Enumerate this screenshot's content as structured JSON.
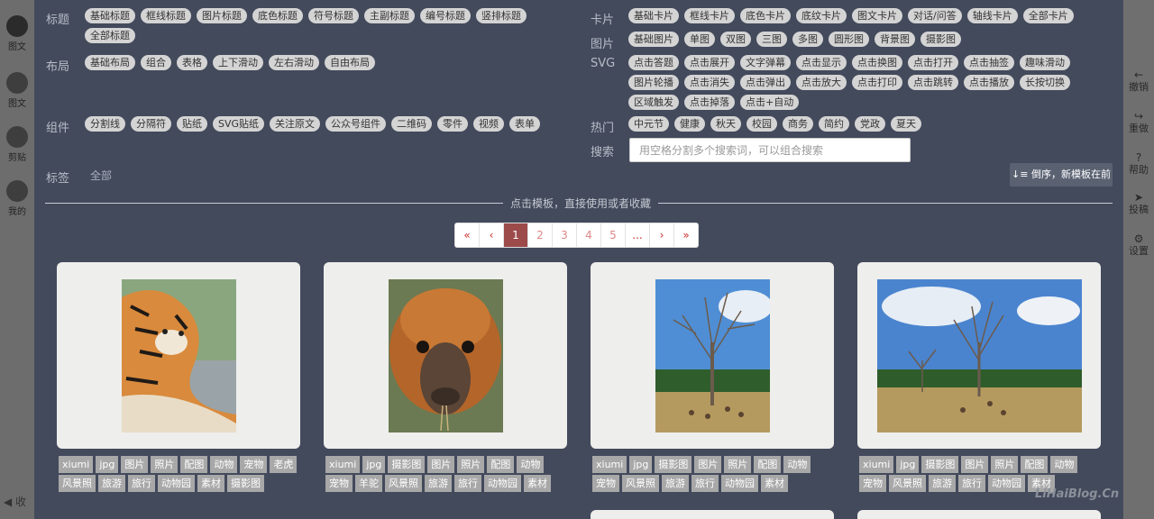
{
  "app": {
    "left_nav": [
      {
        "label": "图文",
        "icon": "document-icon"
      },
      {
        "label": "图文",
        "icon": "list-icon"
      },
      {
        "label": "剪贴",
        "icon": "clipboard-icon"
      },
      {
        "label": "我的",
        "icon": "user-icon"
      }
    ],
    "collapse_label": "◀ 收",
    "right_tools": [
      {
        "icon": "←",
        "label": "撤销"
      },
      {
        "icon": "↪",
        "label": "重做"
      },
      {
        "icon": "?",
        "label": "帮助"
      },
      {
        "icon": "➤",
        "label": "投稿"
      },
      {
        "icon": "⚙",
        "label": "设置"
      }
    ]
  },
  "filters": {
    "title": {
      "label": "标题",
      "tags": [
        "基础标题",
        "框线标题",
        "图片标题",
        "底色标题",
        "符号标题",
        "主副标题",
        "编号标题",
        "竖排标题",
        "全部标题"
      ]
    },
    "layout": {
      "label": "布局",
      "tags": [
        "基础布局",
        "组合",
        "表格",
        "上下滑动",
        "左右滑动",
        "自由布局"
      ]
    },
    "component": {
      "label": "组件",
      "tags": [
        "分割线",
        "分隔符",
        "贴纸",
        "SVG贴纸",
        "关注原文",
        "公众号组件",
        "二维码",
        "零件",
        "视频",
        "表单"
      ]
    },
    "tagfilter": {
      "label": "标签",
      "value": "全部"
    },
    "card": {
      "label": "卡片",
      "tags": [
        "基础卡片",
        "框线卡片",
        "底色卡片",
        "底纹卡片",
        "图文卡片",
        "对话/问答",
        "轴线卡片",
        "全部卡片"
      ]
    },
    "image": {
      "label": "图片",
      "tags": [
        "基础图片",
        "单图",
        "双图",
        "三图",
        "多图",
        "圆形图",
        "背景图",
        "摄影图"
      ]
    },
    "svg": {
      "label": "SVG",
      "tags": [
        "点击答题",
        "点击展开",
        "文字弹幕",
        "点击显示",
        "点击换图",
        "点击打开",
        "点击抽签",
        "趣味滑动",
        "图片轮播",
        "点击消失",
        "点击弹出",
        "点击放大",
        "点击打印",
        "点击跳转",
        "点击播放",
        "长按切换",
        "区域触发",
        "点击掉落",
        "点击+自动"
      ]
    },
    "hot": {
      "label": "热门",
      "tags": [
        "中元节",
        "健康",
        "秋天",
        "校园",
        "商务",
        "简约",
        "党政",
        "夏天"
      ]
    },
    "search": {
      "label": "搜索",
      "placeholder": "用空格分割多个搜索词，可以组合搜索"
    }
  },
  "sort_button": "倒序，新模板在前",
  "divider_text": "点击模板，直接使用或者收藏",
  "pagination": [
    "«",
    "‹",
    "1",
    "2",
    "3",
    "4",
    "5",
    "...",
    "›",
    "»"
  ],
  "pagination_active": "1",
  "cards": [
    {
      "photo": "tiger",
      "tags": [
        "xiumi",
        "jpg",
        "图片",
        "照片",
        "配图",
        "动物",
        "宠物",
        "老虎",
        "风景照",
        "旅游",
        "旅行",
        "动物园",
        "素材",
        "摄影图"
      ]
    },
    {
      "photo": "alpaca",
      "tags": [
        "xiumi",
        "jpg",
        "摄影图",
        "图片",
        "照片",
        "配图",
        "动物",
        "宠物",
        "羊驼",
        "风景照",
        "旅游",
        "旅行",
        "动物园",
        "素材"
      ]
    },
    {
      "photo": "deer-tree-portrait",
      "tags": [
        "xiumi",
        "jpg",
        "摄影图",
        "图片",
        "照片",
        "配图",
        "动物",
        "宠物",
        "风景照",
        "旅游",
        "旅行",
        "动物园",
        "素材"
      ]
    },
    {
      "photo": "deer-tree-landscape",
      "tags": [
        "xiumi",
        "jpg",
        "摄影图",
        "图片",
        "照片",
        "配图",
        "动物",
        "宠物",
        "风景照",
        "旅游",
        "旅行",
        "动物园",
        "素材"
      ]
    }
  ],
  "watermark": "LiHaiBlog.Cn",
  "colors": {
    "panel": "#434a5c",
    "active_page": "#9c4a4a",
    "tag_bg": "#d4d4d4"
  }
}
